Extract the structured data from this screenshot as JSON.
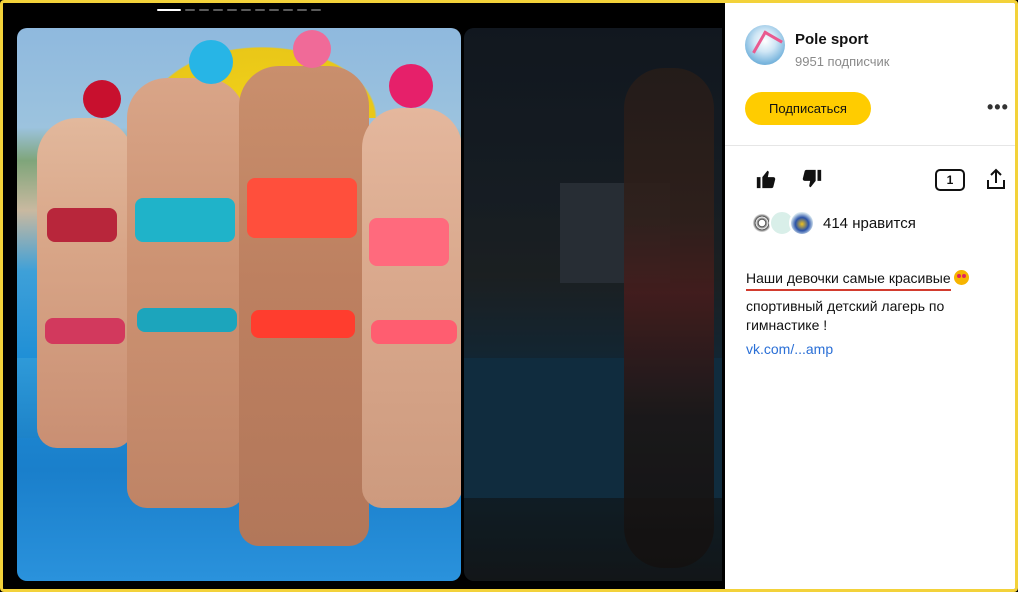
{
  "gallery": {
    "slide_count": 12,
    "active_slide": 1
  },
  "channel": {
    "name": "Pole sport",
    "subscribers": "9951 подписчик",
    "subscribe_label": "Подписаться",
    "more_label": "•••"
  },
  "actions": {
    "comments_count": "1"
  },
  "likes": {
    "text": "414 нравится"
  },
  "post": {
    "title": "Наши девочки самые красивые",
    "text": "спортивный детский лагерь по гимнастике !",
    "link": "vk.com/...amp"
  },
  "icons": {
    "like": "thumbs-up-icon",
    "dislike": "thumbs-down-icon",
    "comments": "comment-icon",
    "share": "share-icon",
    "emoji": "star-struck-emoji"
  },
  "colors": {
    "accent": "#ffcc00",
    "link": "#2a6fd6",
    "frame": "#f3d23a"
  }
}
